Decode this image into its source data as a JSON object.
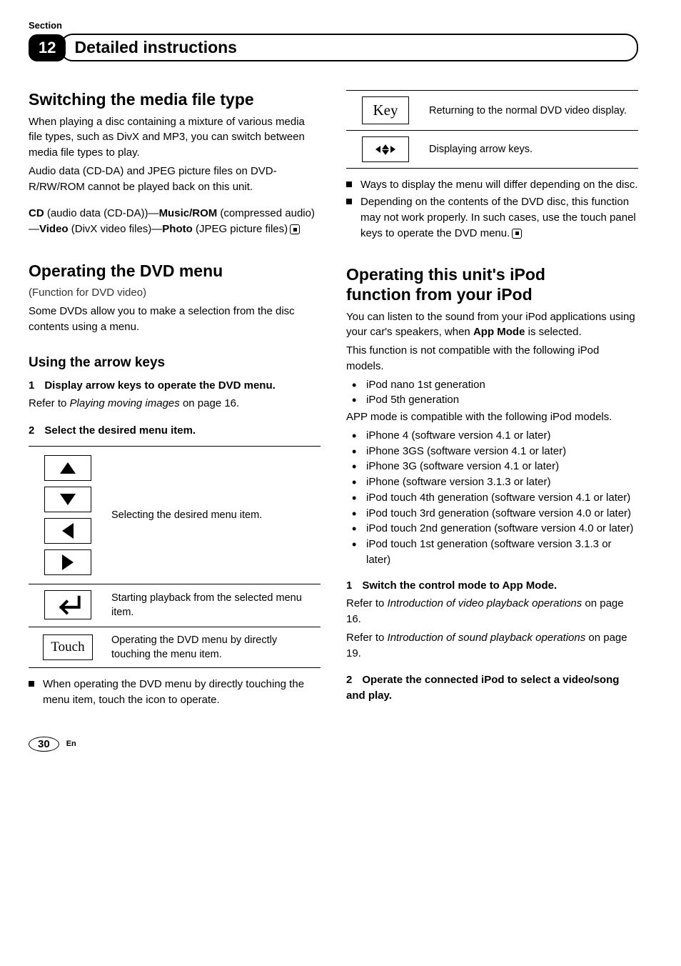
{
  "header": {
    "section_label": "Section",
    "chapter_number": "12",
    "chapter_title": "Detailed instructions"
  },
  "left": {
    "h1a": "Switching the media file type",
    "p1": "When playing a disc containing a mixture of various media file types, such as DivX and MP3, you can switch between media file types to play.",
    "p2": "Audio data (CD-DA) and JPEG picture files on DVD-R/RW/ROM cannot be played back on this unit.",
    "fmt": {
      "cd": "CD",
      "cd_desc": " (audio data (CD-DA))—",
      "music": "Music/ROM",
      "music_desc": " (compressed audio)—",
      "video": "Video",
      "video_desc": " (DivX video files)—",
      "photo": "Photo",
      "photo_desc": " (JPEG picture files)"
    },
    "h1b": "Operating the DVD menu",
    "p3": "(Function for DVD video)",
    "p4": "Some DVDs allow you to make a selection from the disc contents using a menu.",
    "h2a": "Using the arrow keys",
    "step1_num": "1",
    "step1_text": "Display arrow keys to operate the DVD menu.",
    "step1_ref_a": "Refer to ",
    "step1_ref_b": "Playing moving images",
    "step1_ref_c": " on page 16.",
    "step2_num": "2",
    "step2_text": "Select the desired menu item.",
    "table1": {
      "r1_desc": "Selecting the desired menu item.",
      "r2_desc": "Starting playback from the selected menu item.",
      "r3_key": "Touch",
      "r3_desc": "Operating the DVD menu by directly touching the menu item."
    },
    "note1": "When operating the DVD menu by directly touching the menu item, touch the icon to operate."
  },
  "right": {
    "table2": {
      "r1_key": "Key",
      "r1_desc": "Returning to the normal DVD video display.",
      "r2_desc": "Displaying arrow keys."
    },
    "note2": "Ways to display the menu will differ depending on the disc.",
    "note3": "Depending on the contents of the DVD disc, this function may not work properly. In such cases, use the touch panel keys to operate the DVD menu.",
    "h1c_a": "Operating this unit's iPod",
    "h1c_b": "function from your iPod",
    "p5a": "You can listen to the sound from your iPod applications using your car's speakers, when ",
    "p5b": "App Mode",
    "p5c": " is selected.",
    "p6": "This function is not compatible with the following iPod models.",
    "incompat": [
      "iPod nano 1st generation",
      "iPod 5th generation"
    ],
    "p7": "APP mode is compatible with the following iPod models.",
    "compat": [
      "iPhone 4 (software version 4.1 or later)",
      "iPhone 3GS (software version 4.1 or later)",
      "iPhone 3G (software version 4.1 or later)",
      "iPhone (software version 3.1.3 or later)",
      "iPod touch 4th generation (software version 4.1 or later)",
      "iPod touch 3rd generation (software version 4.0 or later)",
      "iPod touch 2nd generation (software version 4.0 or later)",
      "iPod touch 1st generation (software version 3.1.3 or later)"
    ],
    "stepA_num": "1",
    "stepA_text": "Switch the control mode to App Mode.",
    "stepA_ref1a": "Refer to ",
    "stepA_ref1b": "Introduction of video playback operations",
    "stepA_ref1c": " on page 16.",
    "stepA_ref2a": "Refer to ",
    "stepA_ref2b": "Introduction of sound playback operations",
    "stepA_ref2c": " on page 19.",
    "stepB_num": "2",
    "stepB_text": "Operate the connected iPod to select a video/song and play."
  },
  "footer": {
    "page": "30",
    "lang": "En"
  }
}
